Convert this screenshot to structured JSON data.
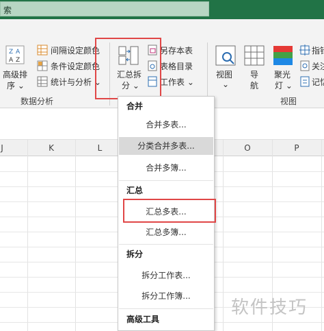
{
  "search": {
    "text": "索"
  },
  "ribbon": {
    "advanced_sort": {
      "line1": "高级排",
      "line2": "序 ⌄"
    },
    "data_tools": [
      "间隔设定颜色",
      "条件设定颜色",
      "统计与分析 ⌄"
    ],
    "data_group_label": "数据分析",
    "summary_split": {
      "line1": "汇总拆",
      "line2": "分 ⌄"
    },
    "save_items": [
      "另存本表",
      "表格目录",
      "工作表 ⌄"
    ],
    "view": {
      "label": "视图",
      "arrow": "⌄"
    },
    "nav": {
      "line1": "导",
      "line2": "航"
    },
    "spotlight": {
      "line1": "聚光",
      "line2": "灯 ⌄"
    },
    "right_items": [
      "指针",
      "关注",
      "记忆"
    ],
    "view_group_label": "视图"
  },
  "columns": [
    "J",
    "K",
    "L",
    "O",
    "P"
  ],
  "menu": {
    "sections": [
      {
        "title": "合并",
        "items": [
          "合并多表...",
          "分类合并多表...",
          "合并多簿..."
        ]
      },
      {
        "title": "汇总",
        "items": [
          "汇总多表...",
          "汇总多簿..."
        ]
      },
      {
        "title": "拆分",
        "items": [
          "拆分工作表...",
          "拆分工作簿..."
        ]
      },
      {
        "title": "高级工具",
        "items": []
      }
    ]
  },
  "watermark": "软件技巧",
  "colors": {
    "title_green": "#217346",
    "highlight_red": "#e04646",
    "menu_hover": "#d9d9d9"
  }
}
